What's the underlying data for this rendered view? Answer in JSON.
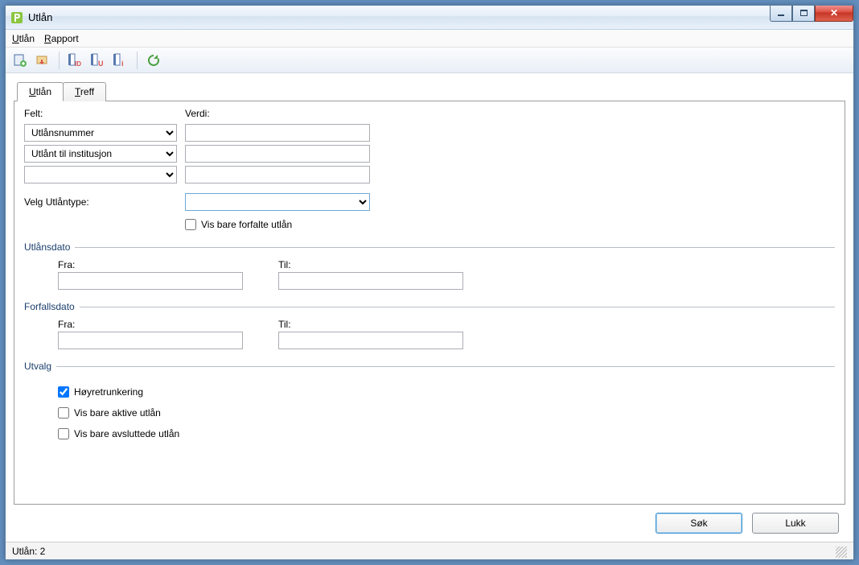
{
  "window": {
    "title": "Utlån"
  },
  "menu": {
    "utlan": "Utlån",
    "rapport": "Rapport"
  },
  "toolbar": {
    "new": "new-record",
    "return": "return",
    "findid": "ID",
    "findu": "U",
    "findi": "i",
    "refresh": "refresh"
  },
  "tabs": {
    "utlan": "Utlån",
    "treff": "Treff"
  },
  "form": {
    "felt_label": "Felt:",
    "verdi_label": "Verdi:",
    "field1_option": "Utlånsnummer",
    "field2_option": "Utlånt til institusjon",
    "field3_option": "",
    "value1": "",
    "value2": "",
    "value3": "",
    "type_label": "Velg Utlåntype:",
    "type_value": "",
    "overdue_label": "Vis bare forfalte utlån",
    "overdue_checked": false
  },
  "utlansdato": {
    "legend": "Utlånsdato",
    "fra_label": "Fra:",
    "til_label": "Til:",
    "fra": "",
    "til": ""
  },
  "forfallsdato": {
    "legend": "Forfallsdato",
    "fra_label": "Fra:",
    "til_label": "Til:",
    "fra": "",
    "til": ""
  },
  "utvalg": {
    "legend": "Utvalg",
    "hoy_label": "Høyretrunkering",
    "hoy_checked": true,
    "aktiv_label": "Vis bare aktive utlån",
    "aktiv_checked": false,
    "avsl_label": "Vis bare avsluttede utlån",
    "avsl_checked": false
  },
  "buttons": {
    "search": "Søk",
    "close": "Lukk"
  },
  "status": {
    "text": "Utlån: 2"
  }
}
